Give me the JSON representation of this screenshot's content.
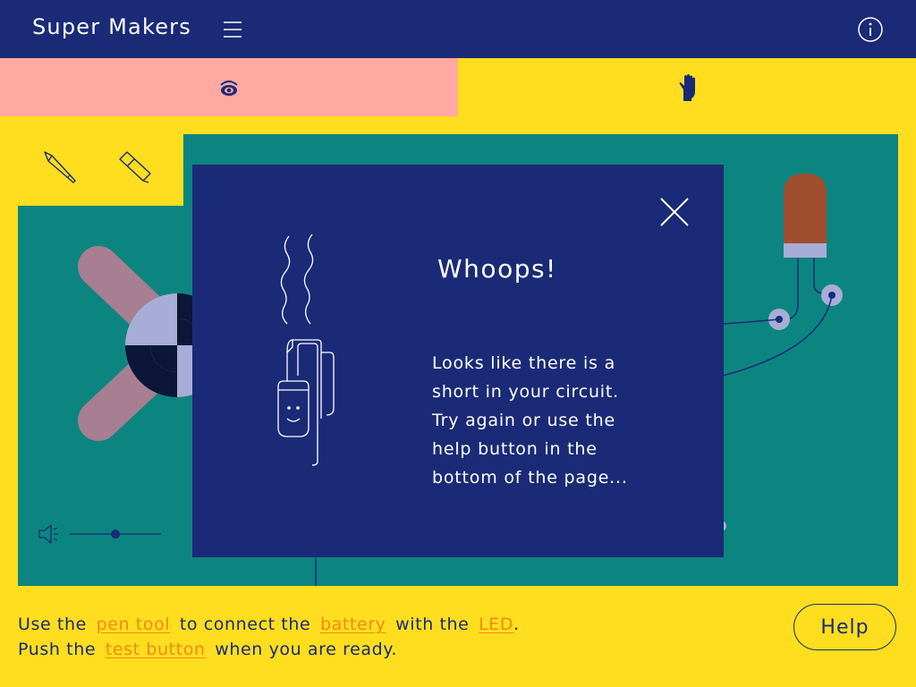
{
  "app": {
    "title": "Super Makers"
  },
  "header": {
    "menu_icon": "hamburger-menu-icon",
    "info_icon": "info-icon"
  },
  "mode_tabs": [
    {
      "id": "look",
      "icon": "eye-icon",
      "color": "#FFA9A3",
      "active": true
    },
    {
      "id": "touch",
      "icon": "hand-icon",
      "color": "#FFDE1F",
      "active": false
    }
  ],
  "tools": [
    {
      "id": "pen",
      "icon": "pencil-icon"
    },
    {
      "id": "eraser",
      "icon": "eraser-icon"
    }
  ],
  "volume": {
    "icon": "speaker-icon",
    "level": 0.5
  },
  "modal": {
    "title": "Whoops!",
    "body_lines": [
      "Looks like there is a",
      "short in your circuit.",
      "Try again or use the",
      "help button in the",
      "bottom of the page..."
    ],
    "close_icon": "close-icon",
    "illustration": "smoking-battery-icon"
  },
  "instructions": {
    "line1": {
      "t1": "Use the",
      "link1": "pen tool",
      "t2": "to connect the",
      "link2": "battery",
      "t3": "with the",
      "link3": "LED",
      "t4": "."
    },
    "line2": {
      "t1": "Push the",
      "link1": "test button",
      "t2": "when you are ready."
    }
  },
  "help": {
    "label": "Help"
  },
  "colors": {
    "navy": "#1B2A77",
    "yellow": "#FFDE1F",
    "pink": "#FFA9A3",
    "teal": "#0C8580",
    "orange_link": "#F28A0F",
    "led_brown": "#A04E2E",
    "mauve": "#A77E92",
    "lavender": "#A7ADD6"
  }
}
